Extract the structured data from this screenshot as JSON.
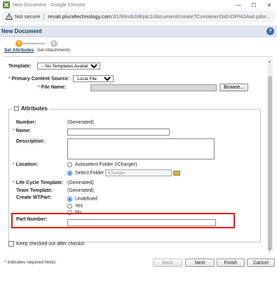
{
  "window": {
    "title": "New Document - Google Chrome",
    "controls": {
      "minimize": "—",
      "maximize": "☐",
      "close": "✕"
    }
  },
  "address_bar": {
    "security_label": "Not secure",
    "url_host": "revati.pluraltechnology.com",
    "url_path": ":81/Windchill/ptc1/document/create?ContainerOid=OR%3Awt.pdm..."
  },
  "dialog": {
    "title": "New Document",
    "help": "?"
  },
  "wizard": {
    "steps": [
      {
        "number": "1",
        "label": "Set Attributes"
      },
      {
        "number": "2",
        "label": "Set Attachments"
      }
    ]
  },
  "form": {
    "template_label": "Template:",
    "template_value": "-- No Templates Available --",
    "primary_source_label": "Primary Content Source:",
    "primary_source_value": "Local File",
    "file_name_label": "File Name:",
    "browse_label": "Browse...",
    "attributes_title": "Attributes",
    "number_label": "Number:",
    "number_value": "(Generated)",
    "name_label": "Name:",
    "description_label": "Description:",
    "location_label": "Location:",
    "location_option1": "Autoselect Folder (/Charger)",
    "location_option2": "Select Folder",
    "location_folder_value": "/Charger",
    "lifecycle_label": "Life Cycle Template:",
    "lifecycle_value": "(Generated)",
    "team_label": "Team Template:",
    "team_value": "(Generated)",
    "wtpart_label": "Create WTPart:",
    "wtpart_options": [
      "Undefined",
      "Yes",
      "No"
    ],
    "part_number_label": "Part Number:",
    "keep_checked_out_label": "Keep checked out after checkin",
    "required_marker": "*"
  },
  "footer": {
    "required_note": "* Indicates required fields.",
    "back": "Back",
    "next": "Next",
    "finish": "Finish",
    "cancel": "Cancel"
  },
  "colors": {
    "header_bg": "#dfe6ee",
    "header_text": "#1e3e61",
    "highlight_border": "#e21b1b",
    "required_red": "#cc0000",
    "radio_selected": "#1a73e8"
  }
}
